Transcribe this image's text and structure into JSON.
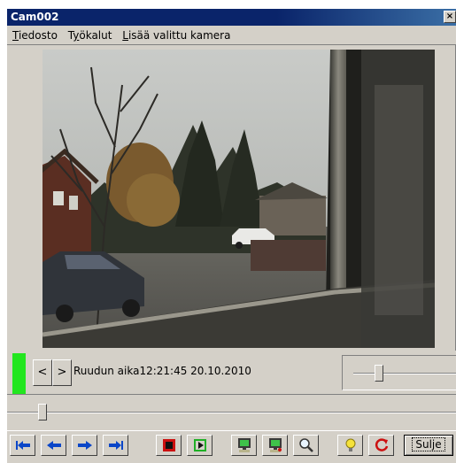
{
  "window": {
    "title": "Cam002",
    "close_glyph": "×"
  },
  "menu": {
    "items": [
      {
        "mnemonic": "T",
        "rest": "iedosto"
      },
      {
        "prefix": "T",
        "mnemonic": "y",
        "rest": "ökalut"
      },
      {
        "mnemonic": "L",
        "rest": "isää valittu kamera"
      }
    ]
  },
  "video": {
    "icon": "camera-feed-image"
  },
  "controls": {
    "prev_label": "<",
    "next_label": ">",
    "frame_time_label": "Ruudun aika",
    "frame_time_value": "12:21:45  20.10.2010",
    "status_color": "#22e61f",
    "speed_level": 0.25
  },
  "timeline": {
    "position": 0.07
  },
  "toolbar": {
    "buttons": [
      {
        "icon": "skip-to-start-icon"
      },
      {
        "icon": "step-back-icon"
      },
      {
        "icon": "step-forward-icon"
      },
      {
        "icon": "skip-to-end-icon"
      },
      {
        "icon": "stop-icon"
      },
      {
        "icon": "play-icon"
      },
      {
        "icon": "monitor-icon"
      },
      {
        "icon": "monitor-record-icon"
      },
      {
        "icon": "zoom-icon"
      },
      {
        "icon": "lightbulb-icon"
      },
      {
        "icon": "refresh-icon"
      }
    ],
    "close_label": "Sulje"
  },
  "colors": {
    "title_bar": "#0a246a",
    "face": "#d4d0c8",
    "icon_blue": "#0a46c8",
    "icon_red": "#cc1010"
  }
}
